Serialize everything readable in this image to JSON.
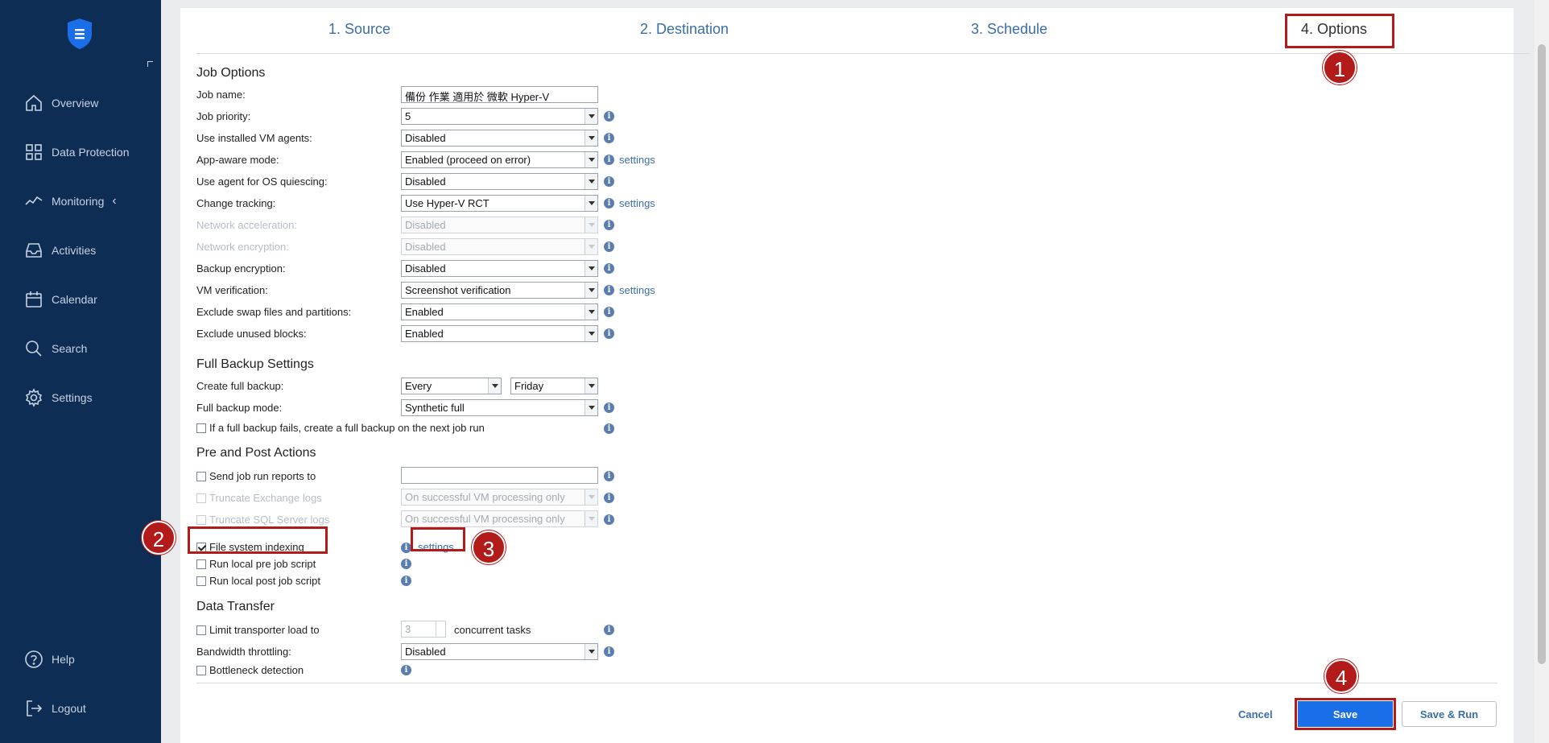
{
  "sidebar": {
    "items": [
      {
        "label": "Overview",
        "icon": "home-icon"
      },
      {
        "label": "Data Protection",
        "icon": "grid-icon"
      },
      {
        "label": "Monitoring",
        "icon": "pulse-icon"
      },
      {
        "label": "Activities",
        "icon": "inbox-icon"
      },
      {
        "label": "Calendar",
        "icon": "calendar-icon"
      },
      {
        "label": "Search",
        "icon": "search-icon"
      },
      {
        "label": "Settings",
        "icon": "gear-icon"
      }
    ],
    "bottom": [
      {
        "label": "Help",
        "icon": "help-icon"
      },
      {
        "label": "Logout",
        "icon": "logout-icon"
      }
    ]
  },
  "tabs": [
    "1. Source",
    "2. Destination",
    "3. Schedule",
    "4. Options"
  ],
  "sections": {
    "job_options": "Job Options",
    "full_backup": "Full Backup Settings",
    "pre_post": "Pre and Post Actions",
    "data_transfer": "Data Transfer"
  },
  "job_options": {
    "job_name_label": "Job name:",
    "job_name_value": "備份 作業 適用於 微軟 Hyper-V",
    "job_priority_label": "Job priority:",
    "job_priority_value": "5",
    "vm_agents_label": "Use installed VM agents:",
    "vm_agents_value": "Disabled",
    "app_aware_label": "App-aware mode:",
    "app_aware_value": "Enabled (proceed on error)",
    "os_quiescing_label": "Use agent for OS quiescing:",
    "os_quiescing_value": "Disabled",
    "change_tracking_label": "Change tracking:",
    "change_tracking_value": "Use Hyper-V RCT",
    "net_accel_label": "Network acceleration:",
    "net_accel_value": "Disabled",
    "net_enc_label": "Network encryption:",
    "net_enc_value": "Disabled",
    "backup_enc_label": "Backup encryption:",
    "backup_enc_value": "Disabled",
    "vm_verif_label": "VM verification:",
    "vm_verif_value": "Screenshot verification",
    "exclude_swap_label": "Exclude swap files and partitions:",
    "exclude_swap_value": "Enabled",
    "exclude_unused_label": "Exclude unused blocks:",
    "exclude_unused_value": "Enabled",
    "settings_link": "settings"
  },
  "full_backup": {
    "create_label": "Create full backup:",
    "create_every": "Every",
    "create_day": "Friday",
    "mode_label": "Full backup mode:",
    "mode_value": "Synthetic full",
    "fail_checkbox": "If a full backup fails, create a full backup on the next job run"
  },
  "pre_post": {
    "send_reports": "Send job run reports to",
    "truncate_exchange": "Truncate Exchange logs",
    "truncate_exchange_value": "On successful VM processing only",
    "truncate_sql": "Truncate SQL Server logs",
    "truncate_sql_value": "On successful VM processing only",
    "fs_indexing": "File system indexing",
    "fs_settings": "settings",
    "pre_script": "Run local pre job script",
    "post_script": "Run local post job script"
  },
  "data_transfer": {
    "limit_label": "Limit transporter load to",
    "limit_value": "3",
    "concurrent": "concurrent tasks",
    "throttling_label": "Bandwidth throttling:",
    "throttling_value": "Disabled",
    "bottleneck": "Bottleneck detection"
  },
  "footer": {
    "cancel": "Cancel",
    "save": "Save",
    "save_run": "Save & Run"
  },
  "annotations": [
    "1",
    "2",
    "3",
    "4"
  ],
  "colors": {
    "sidebar_bg": "#0d2d55",
    "accent": "#1a6fe8",
    "highlight": "#b31b1b",
    "link": "#3a6ea5"
  }
}
